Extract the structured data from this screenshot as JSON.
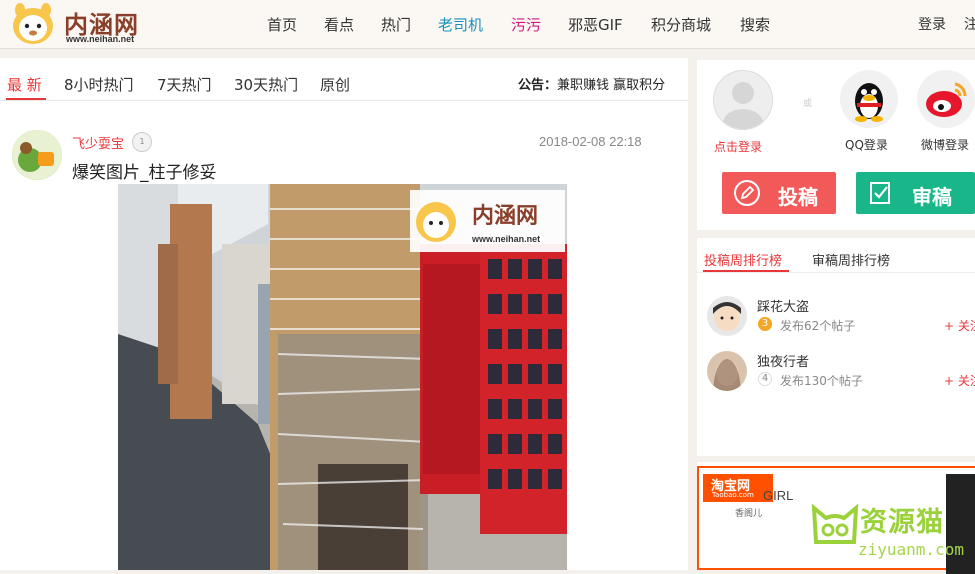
{
  "header": {
    "logo_text": "内涵网",
    "logo_url": "www.neihan.net",
    "nav": [
      {
        "label": "首页",
        "style": "normal"
      },
      {
        "label": "看点",
        "style": "normal"
      },
      {
        "label": "热门",
        "style": "normal"
      },
      {
        "label": "老司机",
        "style": "teal"
      },
      {
        "label": "污污",
        "style": "pink"
      },
      {
        "label": "邪恶GIF",
        "style": "normal"
      },
      {
        "label": "积分商城",
        "style": "normal"
      },
      {
        "label": "搜索",
        "style": "normal"
      }
    ],
    "login_label": "登录",
    "register_label": "注"
  },
  "tabs": [
    "最 新",
    "8小时热门",
    "7天热门",
    "30天热门",
    "原创"
  ],
  "active_tab": 0,
  "notice": {
    "label": "公告：",
    "text": "兼职赚钱 赢取积分"
  },
  "post": {
    "author": "飞少耍宝",
    "level": "1",
    "date": "2018-02-08 22:18",
    "title": "爆笑图片_柱子修妥",
    "image_watermark_text": "内涵网",
    "image_watermark_url": "www.neihan.net"
  },
  "sidebar": {
    "click_login": "点击登录",
    "or_text": "或",
    "qq_login": "QQ登录",
    "weibo_login": "微博登录",
    "submit_button": "投稿",
    "review_button": "审稿",
    "rank_tabs": [
      "投稿周排行榜",
      "审稿周排行榜"
    ],
    "rank_list": [
      {
        "rank": "3",
        "name": "踩花大盗",
        "desc": "发布62个帖子",
        "follow": "+ 关注",
        "badge_color": "#f5a623"
      },
      {
        "rank": "4",
        "name": "独夜行者",
        "desc": "发布130个帖子",
        "follow": "+ 关注",
        "badge_color": "#cccccc"
      }
    ],
    "ad": {
      "brand": "淘宝网",
      "brand_url": "Taobao.com",
      "title": "GIRL",
      "subtitle": "香阁儿"
    }
  },
  "watermark": {
    "text": "资源猫",
    "url": "ziyuanm.com"
  }
}
